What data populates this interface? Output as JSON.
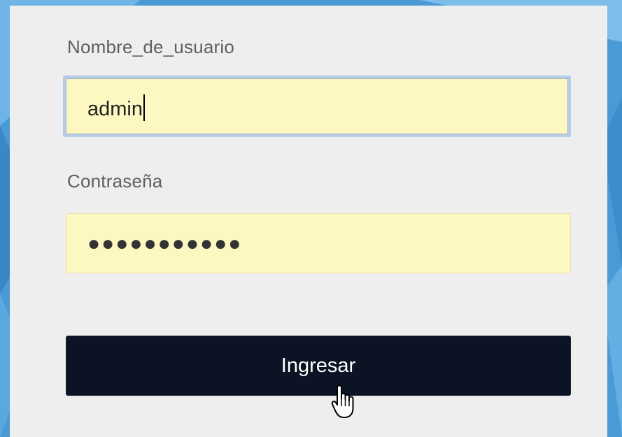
{
  "login_form": {
    "username_label": "Nombre_de_usuario",
    "username_value": "admin",
    "password_label": "Contraseña",
    "password_masked": "●●●●●●●●●●●",
    "submit_label": "Ingresar"
  },
  "colors": {
    "panel_bg": "#eeeeee",
    "input_bg": "#fdf7c2",
    "focus_border": "#b6cde8",
    "button_bg": "#0b1324",
    "button_text": "#ffffff",
    "label_text": "#5f5f5f",
    "page_bg": "#4a9ad6"
  },
  "icons": {
    "cursor": "hand-pointer-icon"
  }
}
